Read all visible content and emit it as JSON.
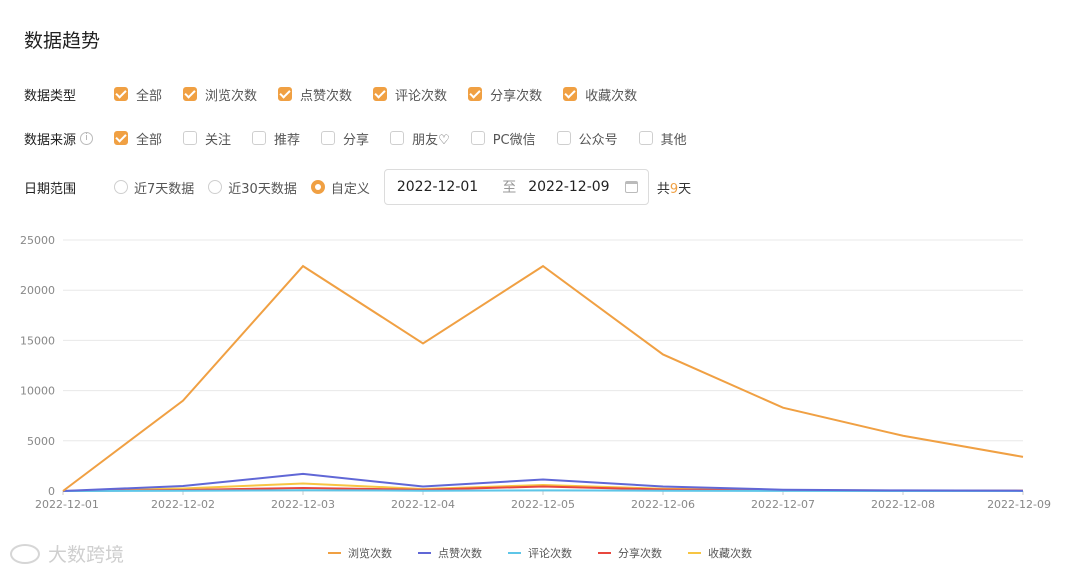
{
  "title": "数据趋势",
  "data_type": {
    "label": "数据类型",
    "options": [
      {
        "label": "全部",
        "checked": true
      },
      {
        "label": "浏览次数",
        "checked": true
      },
      {
        "label": "点赞次数",
        "checked": true
      },
      {
        "label": "评论次数",
        "checked": true
      },
      {
        "label": "分享次数",
        "checked": true
      },
      {
        "label": "收藏次数",
        "checked": true
      }
    ]
  },
  "data_source": {
    "label": "数据来源",
    "options": [
      {
        "label": "全部",
        "checked": true
      },
      {
        "label": "关注",
        "checked": false
      },
      {
        "label": "推荐",
        "checked": false
      },
      {
        "label": "分享",
        "checked": false
      },
      {
        "label": "朋友♡",
        "checked": false
      },
      {
        "label": "PC微信",
        "checked": false
      },
      {
        "label": "公众号",
        "checked": false
      },
      {
        "label": "其他",
        "checked": false
      }
    ]
  },
  "date_range": {
    "label": "日期范围",
    "options": [
      {
        "label": "近7天数据",
        "selected": false
      },
      {
        "label": "近30天数据",
        "selected": false
      },
      {
        "label": "自定义",
        "selected": true
      }
    ],
    "start": "2022-12-01",
    "separator": "至",
    "end": "2022-12-09",
    "total_prefix": "共",
    "total_days": "9",
    "total_suffix": "天"
  },
  "watermark": "大数跨境",
  "colors": {
    "accent": "#f0a043"
  },
  "chart_data": {
    "type": "line",
    "x": [
      "2022-12-01",
      "2022-12-02",
      "2022-12-03",
      "2022-12-04",
      "2022-12-05",
      "2022-12-06",
      "2022-12-07",
      "2022-12-08",
      "2022-12-09"
    ],
    "ylim": [
      0,
      25000
    ],
    "yticks": [
      0,
      5000,
      10000,
      15000,
      20000,
      25000
    ],
    "grid": true,
    "legend_position": "bottom-center",
    "series": [
      {
        "name": "浏览次数",
        "color": "#f0a043",
        "values": [
          0,
          9000,
          22400,
          14700,
          22400,
          13600,
          8300,
          5500,
          3400
        ]
      },
      {
        "name": "点赞次数",
        "color": "#6067d6",
        "values": [
          0,
          500,
          1700,
          450,
          1150,
          450,
          130,
          60,
          30
        ]
      },
      {
        "name": "评论次数",
        "color": "#5ec6e8",
        "values": [
          0,
          20,
          80,
          30,
          60,
          30,
          10,
          5,
          3
        ]
      },
      {
        "name": "分享次数",
        "color": "#e8473e",
        "values": [
          0,
          100,
          300,
          120,
          450,
          150,
          60,
          30,
          20
        ]
      },
      {
        "name": "收藏次数",
        "color": "#f7c543",
        "values": [
          0,
          250,
          750,
          200,
          600,
          220,
          80,
          40,
          25
        ]
      }
    ]
  }
}
